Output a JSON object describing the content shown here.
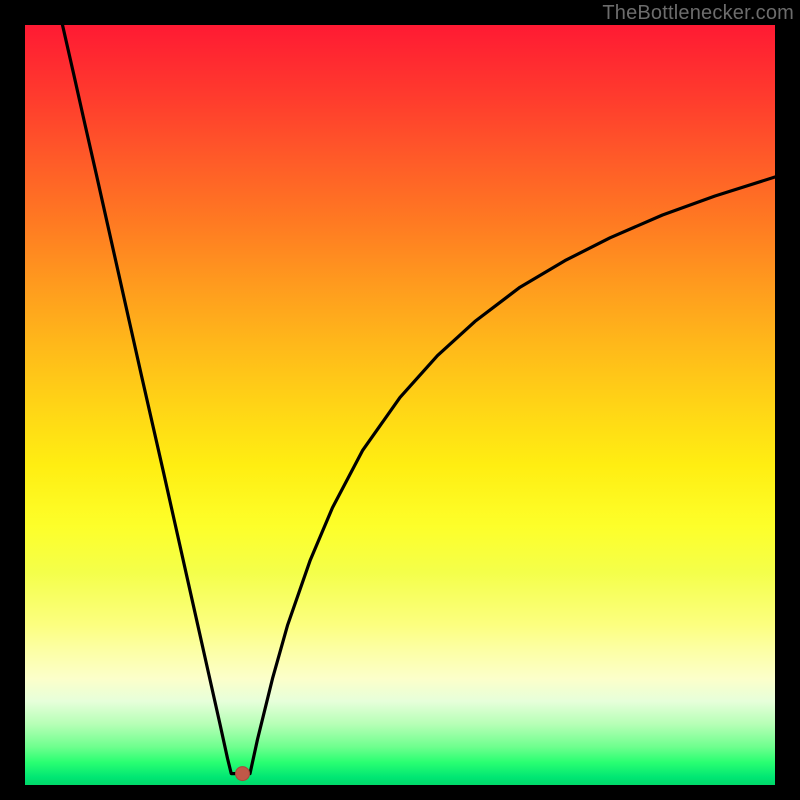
{
  "attribution": "TheBottlenecker.com",
  "colors": {
    "page_bg": "#000000",
    "curve": "#000000",
    "marker_fill": "#c05848",
    "marker_stroke": "#a8483a",
    "gradient_top": "#ff1a33",
    "gradient_bottom": "#00d869",
    "attribution_text": "#6c6c6c"
  },
  "chart_data": {
    "type": "line",
    "title": "",
    "xlabel": "",
    "ylabel": "",
    "xlim": [
      0,
      100
    ],
    "ylim": [
      0,
      100
    ],
    "grid": false,
    "legend": false,
    "marker": {
      "x": 29,
      "y": 1.5,
      "label": "minimum"
    },
    "series": [
      {
        "name": "left-branch",
        "x": [
          5.0,
          6.5,
          8.0,
          9.5,
          11.0,
          12.5,
          14.0,
          15.5,
          17.0,
          18.5,
          20.0,
          21.5,
          23.0,
          24.5,
          26.0,
          27.0,
          27.5,
          28.0
        ],
        "y": [
          100.0,
          93.5,
          86.9,
          80.4,
          73.8,
          67.2,
          60.6,
          54.0,
          47.5,
          41.0,
          34.4,
          27.8,
          21.2,
          14.6,
          8.0,
          3.5,
          1.5,
          1.5
        ]
      },
      {
        "name": "plateau",
        "x": [
          28.0,
          30.0
        ],
        "y": [
          1.5,
          1.5
        ]
      },
      {
        "name": "right-branch",
        "x": [
          30.0,
          31.0,
          33.0,
          35.0,
          38.0,
          41.0,
          45.0,
          50.0,
          55.0,
          60.0,
          66.0,
          72.0,
          78.0,
          85.0,
          92.0,
          100.0
        ],
        "y": [
          1.5,
          6.0,
          14.0,
          21.0,
          29.5,
          36.5,
          44.0,
          51.0,
          56.5,
          61.0,
          65.5,
          69.0,
          72.0,
          75.0,
          77.5,
          80.0
        ]
      }
    ]
  }
}
